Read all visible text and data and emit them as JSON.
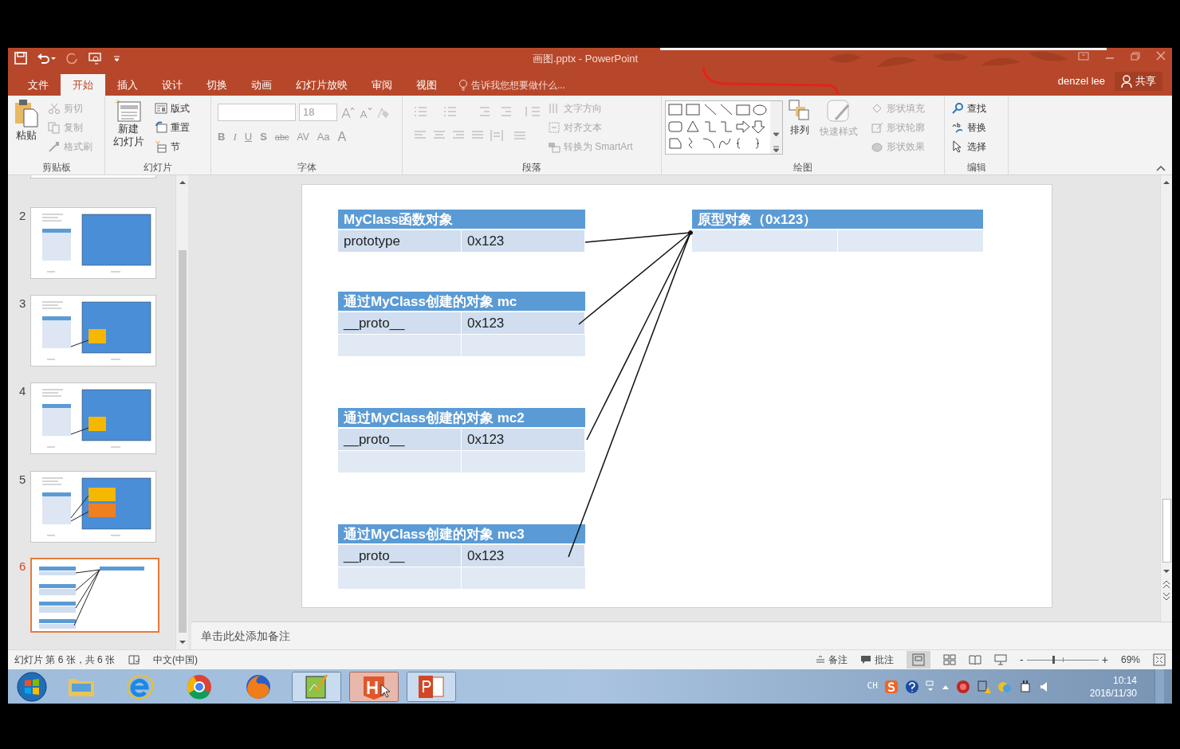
{
  "title_bar": {
    "title": "画图.pptx - PowerPoint",
    "user": "denzel lee",
    "share": "共享"
  },
  "tabs": [
    {
      "label": "文件",
      "selected": false
    },
    {
      "label": "开始",
      "selected": true
    },
    {
      "label": "插入",
      "selected": false
    },
    {
      "label": "设计",
      "selected": false
    },
    {
      "label": "切换",
      "selected": false
    },
    {
      "label": "动画",
      "selected": false
    },
    {
      "label": "幻灯片放映",
      "selected": false
    },
    {
      "label": "审阅",
      "selected": false
    },
    {
      "label": "视图",
      "selected": false
    }
  ],
  "tell_me": "告诉我您想要做什么...",
  "ribbon": {
    "clipboard": {
      "label": "剪贴板",
      "paste": "粘贴",
      "items": [
        {
          "label": "剪切",
          "disabled": true
        },
        {
          "label": "复制",
          "disabled": true
        },
        {
          "label": "格式刷",
          "disabled": true
        }
      ]
    },
    "slides": {
      "label": "幻灯片",
      "new_slide": [
        "新建",
        "幻灯片"
      ],
      "items": [
        {
          "label": "版式",
          "disabled": false
        },
        {
          "label": "重置",
          "disabled": false
        },
        {
          "label": "节",
          "disabled": false
        }
      ]
    },
    "font": {
      "label": "字体",
      "font_size": "18",
      "format_buttons": [
        "B",
        "I",
        "U",
        "S",
        "abc",
        "AV",
        "Aa",
        "A"
      ]
    },
    "paragraph": {
      "label": "段落",
      "items": [
        {
          "label": "文字方向",
          "disabled": true
        },
        {
          "label": "对齐文本",
          "disabled": true
        },
        {
          "label": "转换为 SmartArt",
          "disabled": true
        }
      ]
    },
    "drawing": {
      "label": "绘图",
      "arrange": {
        "label": "排列",
        "disabled": false
      },
      "quick_styles": {
        "label": "快速样式",
        "disabled": true
      },
      "items": [
        {
          "label": "形状填充",
          "disabled": true
        },
        {
          "label": "形状轮廓",
          "disabled": true
        },
        {
          "label": "形状效果",
          "disabled": true
        }
      ]
    },
    "editing": {
      "label": "编辑",
      "items": [
        {
          "label": "查找",
          "disabled": false
        },
        {
          "label": "替换",
          "disabled": false
        },
        {
          "label": "选择",
          "disabled": false
        }
      ]
    }
  },
  "thumbnails": [
    {
      "kind": "partial",
      "selected": false
    },
    {
      "kind": "blue",
      "number": "2",
      "selected": false
    },
    {
      "kind": "blue_yellow",
      "number": "3",
      "selected": false
    },
    {
      "kind": "blue_yellow",
      "number": "4",
      "selected": false
    },
    {
      "kind": "blue_two",
      "number": "5",
      "selected": false
    },
    {
      "kind": "diagram",
      "number": "6",
      "selected": true
    }
  ],
  "slide": {
    "tables": [
      {
        "header": "MyClass函数对象",
        "rows": [
          {
            "kind": "data",
            "cells": [
              "prototype",
              "0x123"
            ]
          }
        ]
      },
      {
        "header": "原型对象（0x123）",
        "rows": [
          {
            "kind": "blank"
          }
        ]
      },
      {
        "header": "通过MyClass创建的对象 mc",
        "rows": [
          {
            "kind": "data",
            "cells": [
              "__proto__",
              "0x123"
            ]
          },
          {
            "kind": "blank"
          }
        ]
      },
      {
        "header": "通过MyClass创建的对象 mc2",
        "rows": [
          {
            "kind": "data",
            "cells": [
              "__proto__",
              "0x123"
            ]
          },
          {
            "kind": "blank"
          }
        ]
      },
      {
        "header": "通过MyClass创建的对象 mc3",
        "rows": [
          {
            "kind": "data",
            "cells": [
              "__proto__",
              "0x123"
            ]
          },
          {
            "kind": "blank"
          }
        ]
      }
    ]
  },
  "notes_placeholder": "单击此处添加备注",
  "status_bar": {
    "slide_info": "幻灯片 第 6 张，共 6 张",
    "language": "中文(中国)",
    "notes": "备注",
    "comments": "批注",
    "zoom_minus": "-",
    "zoom_plus": "+",
    "zoom_slider": {
      "level": 0.37
    },
    "zoom": "69%"
  },
  "taskbar": {
    "input_indicator": "CH",
    "time": "10:14",
    "date": "2016/11/30"
  }
}
